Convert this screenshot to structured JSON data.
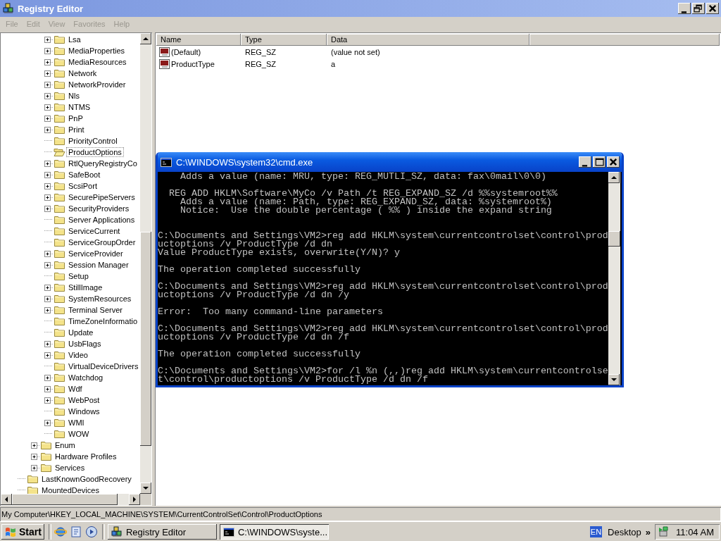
{
  "registry_window": {
    "title": "Registry Editor",
    "active": false,
    "menu": [
      {
        "label": "File"
      },
      {
        "label": "Edit"
      },
      {
        "label": "View"
      },
      {
        "label": "Favorites"
      },
      {
        "label": "Help"
      }
    ],
    "tree": {
      "items": [
        {
          "children": [
            {
              "children": [
                {
                  "label": "Lsa",
                  "expandable": true,
                  "selected": false
                },
                {
                  "label": "MediaProperties",
                  "expandable": true,
                  "selected": false
                },
                {
                  "label": "MediaResources",
                  "expandable": true,
                  "selected": false
                },
                {
                  "label": "Network",
                  "expandable": true,
                  "selected": false
                },
                {
                  "label": "NetworkProvider",
                  "expandable": true,
                  "selected": false
                },
                {
                  "label": "Nls",
                  "expandable": true,
                  "selected": false
                },
                {
                  "label": "NTMS",
                  "expandable": true,
                  "selected": false
                },
                {
                  "label": "PnP",
                  "expandable": true,
                  "selected": false
                },
                {
                  "label": "Print",
                  "expandable": true,
                  "selected": false
                },
                {
                  "label": "PriorityControl",
                  "expandable": false,
                  "selected": false
                },
                {
                  "label": "ProductOptions",
                  "expandable": false,
                  "selected": true
                },
                {
                  "label": "RtlQueryRegistryCo",
                  "expandable": true,
                  "selected": false
                },
                {
                  "label": "SafeBoot",
                  "expandable": true,
                  "selected": false
                },
                {
                  "label": "ScsiPort",
                  "expandable": true,
                  "selected": false
                },
                {
                  "label": "SecurePipeServers",
                  "expandable": true,
                  "selected": false
                },
                {
                  "label": "SecurityProviders",
                  "expandable": true,
                  "selected": false
                },
                {
                  "label": "Server Applications",
                  "expandable": false,
                  "selected": false
                },
                {
                  "label": "ServiceCurrent",
                  "expandable": false,
                  "selected": false
                },
                {
                  "label": "ServiceGroupOrder",
                  "expandable": false,
                  "selected": false
                },
                {
                  "label": "ServiceProvider",
                  "expandable": true,
                  "selected": false
                },
                {
                  "label": "Session Manager",
                  "expandable": true,
                  "selected": false
                },
                {
                  "label": "Setup",
                  "expandable": false,
                  "selected": false
                },
                {
                  "label": "StillImage",
                  "expandable": true,
                  "selected": false
                },
                {
                  "label": "SystemResources",
                  "expandable": true,
                  "selected": false
                },
                {
                  "label": "Terminal Server",
                  "expandable": true,
                  "selected": false
                },
                {
                  "label": "TimeZoneInformatio",
                  "expandable": false,
                  "selected": false
                },
                {
                  "label": "Update",
                  "expandable": false,
                  "selected": false
                },
                {
                  "label": "UsbFlags",
                  "expandable": true,
                  "selected": false
                },
                {
                  "label": "Video",
                  "expandable": true,
                  "selected": false
                },
                {
                  "label": "VirtualDeviceDrivers",
                  "expandable": false,
                  "selected": false
                },
                {
                  "label": "Watchdog",
                  "expandable": true,
                  "selected": false
                },
                {
                  "label": "Wdf",
                  "expandable": true,
                  "selected": false
                },
                {
                  "label": "WebPost",
                  "expandable": true,
                  "selected": false
                },
                {
                  "label": "Windows",
                  "expandable": false,
                  "selected": false
                },
                {
                  "label": "WMI",
                  "expandable": true,
                  "selected": false
                },
                {
                  "label": "WOW",
                  "expandable": false,
                  "selected": false
                }
              ]
            },
            {
              "label": "Enum",
              "expandable": true,
              "selected": false
            },
            {
              "label": "Hardware Profiles",
              "expandable": true,
              "selected": false
            },
            {
              "label": "Services",
              "expandable": true,
              "selected": false
            }
          ]
        },
        {
          "label": "LastKnownGoodRecovery",
          "expandable": false,
          "selected": false
        },
        {
          "label": "MountedDevices",
          "expandable": false,
          "selected": false
        }
      ]
    },
    "list": {
      "columns": [
        "Name",
        "Type",
        "Data"
      ],
      "rows": [
        {
          "name": "(Default)",
          "type": "REG_SZ",
          "data": "(value not set)"
        },
        {
          "name": "ProductType",
          "type": "REG_SZ",
          "data": "a"
        }
      ]
    },
    "status_bar": "My Computer\\HKEY_LOCAL_MACHINE\\SYSTEM\\CurrentControlSet\\Control\\ProductOptions"
  },
  "console_window": {
    "title": "C:\\WINDOWS\\system32\\cmd.exe",
    "active": true,
    "lines": [
      {
        "kind": "text",
        "text": "    Adds a value (name: MRU, type: REG_MUTLI_SZ, data: fax\\0mail\\0\\0)"
      },
      {
        "kind": "blank"
      },
      {
        "kind": "text",
        "text": "  REG ADD HKLM\\Software\\MyCo /v Path /t REG_EXPAND_SZ /d %%systemroot%%"
      },
      {
        "kind": "text",
        "text": "    Adds a value (name: Path, type: REG_EXPAND_SZ, data: %systemroot%)"
      },
      {
        "kind": "text",
        "text": "    Notice:  Use the double percentage ( %% ) inside the expand string"
      },
      {
        "kind": "blank"
      },
      {
        "kind": "blank"
      },
      {
        "kind": "text",
        "text": "C:\\Documents and Settings\\VM2>reg add HKLM\\system\\currentcontrolset\\control\\prod"
      },
      {
        "kind": "text",
        "text": "uctoptions /v ProductType /d dn"
      },
      {
        "kind": "text",
        "text": "Value ProductType exists, overwrite(Y/N)? y"
      },
      {
        "kind": "blank"
      },
      {
        "kind": "text",
        "text": "The operation completed successfully"
      },
      {
        "kind": "blank"
      },
      {
        "kind": "text",
        "text": "C:\\Documents and Settings\\VM2>reg add HKLM\\system\\currentcontrolset\\control\\prod"
      },
      {
        "kind": "text",
        "text": "uctoptions /v ProductType /d dn /y"
      },
      {
        "kind": "blank"
      },
      {
        "kind": "text",
        "text": "Error:  Too many command-line parameters"
      },
      {
        "kind": "blank"
      },
      {
        "kind": "text",
        "text": "C:\\Documents and Settings\\VM2>reg add HKLM\\system\\currentcontrolset\\control\\prod"
      },
      {
        "kind": "text",
        "text": "uctoptions /v ProductType /d dn /f"
      },
      {
        "kind": "blank"
      },
      {
        "kind": "text",
        "text": "The operation completed successfully"
      },
      {
        "kind": "blank"
      },
      {
        "kind": "text",
        "text": "C:\\Documents and Settings\\VM2>for /l %n (,,)reg add HKLM\\system\\currentcontrolse"
      },
      {
        "kind": "text",
        "text": "t\\control\\productoptions /v ProductType /d dn /f"
      }
    ]
  },
  "taskbar": {
    "start": "Start",
    "tasks": [
      {
        "label": "Registry Editor",
        "kind": "registry",
        "selected": false
      },
      {
        "label": "C:\\WINDOWS\\syste...",
        "kind": "console",
        "selected": true
      }
    ],
    "language": "EN",
    "toolbar": "Desktop",
    "chevron": "»",
    "clock": "11:04 AM"
  }
}
